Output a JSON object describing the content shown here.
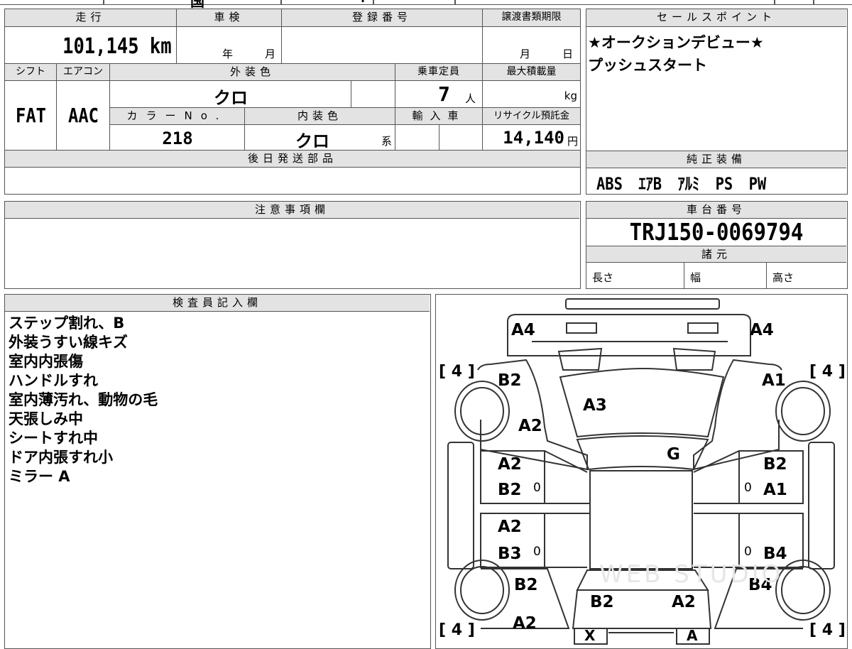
{
  "top_fragment": {
    "partial_text": "国",
    "partial_mark": "."
  },
  "headers": {
    "mileage": "走行",
    "inspection": "車検",
    "registration": "登録番号",
    "transfer_deadline": "譲渡書類期限",
    "sales_point": "セールスポイント",
    "shift": "シフト",
    "aircon": "エアコン",
    "exterior_color": "外装色",
    "capacity": "乗車定員",
    "max_load": "最大積載量",
    "color_no": "カラーNo.",
    "interior_color": "内装色",
    "import": "輸入車",
    "recycle": "リサイクル預託金",
    "later_parts": "後日発送部品",
    "genuine_equipment": "純正装備",
    "notes": "注意事項欄",
    "chassis_no": "車台番号",
    "specs": "諸元",
    "inspector": "検査員記入欄"
  },
  "values": {
    "mileage": "101,145 km",
    "inspection_year_unit": "年",
    "inspection_month_unit": "月",
    "deadline_month_unit": "月",
    "deadline_day_unit": "日",
    "shift": "FAT",
    "aircon": "AAC",
    "exterior_color": "クロ",
    "capacity": "7",
    "capacity_unit": "人",
    "max_load_unit": "kg",
    "color_no": "218",
    "interior_color": "クロ",
    "interior_suffix": "系",
    "recycle": "14,140",
    "recycle_unit": "円",
    "chassis_no": "TRJ150-0069794",
    "spec_length": "長さ",
    "spec_width": "幅",
    "spec_height": "高さ"
  },
  "sales_point_lines": [
    "★オークションデビュー★",
    "プッシュスタート"
  ],
  "equipment": [
    "ABS",
    "ｴｱB",
    "ｱﾙﾐ",
    "PS",
    "PW"
  ],
  "inspector_notes": [
    "ステップ割れ、B",
    "外装うすい線キズ",
    "室内内張傷",
    "ハンドルすれ",
    "室内薄汚れ、動物の毛",
    "天張しみ中",
    "シートすれ中",
    "ドア内張すれ小",
    "ミラー A"
  ],
  "diagram": {
    "front_left": "A4",
    "front_right": "A4",
    "left_front_fender": "B2",
    "right_front_fender": "A1",
    "hood": "A3",
    "left_fender_low": "A2",
    "windshield": "G",
    "left_front_door_top": "A2",
    "left_front_door_bottom": "B2",
    "right_front_door_top": "B2",
    "right_front_door_bottom": "A1",
    "left_rear_door_top": "A2",
    "left_rear_door_bottom": "B3",
    "right_rear_door_bottom": "B4",
    "left_rear_fender": "B2",
    "right_rear_fender": "B4",
    "rear_left": "B2",
    "rear_right": "A2",
    "left_rear_bottom": "A2",
    "tire_fl": "4",
    "tire_fr": "4",
    "tire_rl": "4",
    "tire_rr": "4",
    "zero_mark": "0",
    "bottom_left_box": "X",
    "bottom_right_box": "A",
    "watermark": "WEB STUDIO"
  }
}
